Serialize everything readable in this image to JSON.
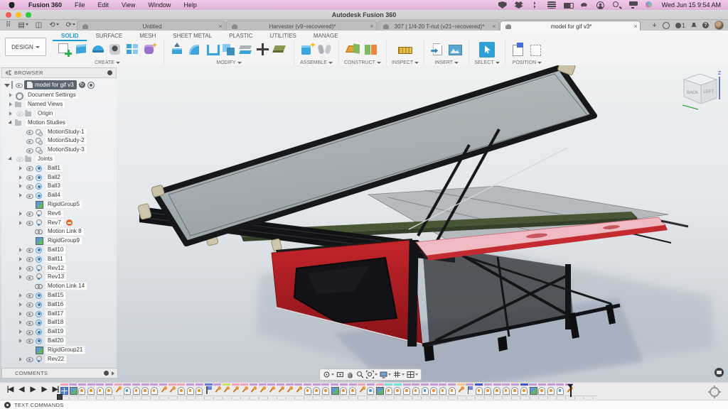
{
  "menubar": {
    "app_name": "Fusion 360",
    "items": [
      "File",
      "Edit",
      "View",
      "Window",
      "Help"
    ],
    "status_icons": [
      "shield",
      "dropbox",
      "bluetooth",
      "keyboard",
      "battery",
      "wifi",
      "account",
      "search",
      "display",
      "siri"
    ],
    "clock": "Wed Jun 15 9:54 AM"
  },
  "titlebar": {
    "title": "Autodesk Fusion 360"
  },
  "tabbar": {
    "close_glyph": "×",
    "new_tab_glyph": "+",
    "job_count": "1",
    "help_glyph": "?",
    "tabs": [
      {
        "label": "Untitled",
        "active": false
      },
      {
        "label": "Harvester (v9~recovered)*",
        "active": false
      },
      {
        "label": "307 | 1/4-20 T-nut (v21~recovered)*",
        "active": false
      },
      {
        "label": "model for gif v3*",
        "active": true
      }
    ]
  },
  "ribbon": {
    "workspace": "DESIGN",
    "tabs": [
      "SOLID",
      "SURFACE",
      "MESH",
      "SHEET METAL",
      "PLASTIC",
      "UTILITIES",
      "MANAGE"
    ],
    "active_tab": "SOLID",
    "groups": [
      {
        "label": "CREATE",
        "icons": [
          "sketch",
          "extrude",
          "revolve",
          "hole",
          "pattern",
          "form"
        ]
      },
      {
        "label": "MODIFY",
        "icons": [
          "presspull",
          "fillet",
          "shell",
          "combine",
          "offset",
          "move",
          "paint"
        ]
      },
      {
        "label": "ASSEMBLE",
        "icons": [
          "newcomp",
          "joint"
        ]
      },
      {
        "label": "CONSTRUCT",
        "icons": [
          "plane",
          "plane2"
        ]
      },
      {
        "label": "INSPECT",
        "icons": [
          "measure"
        ]
      },
      {
        "label": "INSERT",
        "icons": [
          "insert",
          "image"
        ]
      },
      {
        "label": "SELECT",
        "icons": [
          "select"
        ]
      },
      {
        "label": "POSITION",
        "icons": [
          "capture",
          "revert"
        ]
      }
    ]
  },
  "browser": {
    "header": "BROWSER",
    "root_label": "model for gif v3",
    "items": [
      {
        "label": "Document Settings",
        "icon": "gear",
        "arrow": "closed",
        "eye": "none",
        "depth": 1
      },
      {
        "label": "Named Views",
        "icon": "folder",
        "arrow": "closed",
        "eye": "none",
        "depth": 1
      },
      {
        "label": "Origin",
        "icon": "folder",
        "arrow": "closed",
        "eye": "dim",
        "depth": 1
      },
      {
        "label": "Motion Studies",
        "icon": "folder",
        "arrow": "open",
        "eye": "none",
        "depth": 1
      },
      {
        "label": "MotionStudy-1",
        "icon": "motion",
        "arrow": "none",
        "eye": "on",
        "depth": 2
      },
      {
        "label": "MotionStudy-2",
        "icon": "motion",
        "arrow": "none",
        "eye": "on",
        "depth": 2
      },
      {
        "label": "MotionStudy-3",
        "icon": "motion",
        "arrow": "none",
        "eye": "on",
        "depth": 2
      },
      {
        "label": "Joints",
        "icon": "folder",
        "arrow": "open",
        "eye": "dim",
        "depth": 1
      },
      {
        "label": "Ball1",
        "icon": "ball",
        "arrow": "closed",
        "eye": "on",
        "depth": 2
      },
      {
        "label": "Ball2",
        "icon": "ball",
        "arrow": "closed",
        "eye": "on",
        "depth": 2
      },
      {
        "label": "Ball3",
        "icon": "ball",
        "arrow": "closed",
        "eye": "on",
        "depth": 2
      },
      {
        "label": "Ball4",
        "icon": "ball",
        "arrow": "closed",
        "eye": "on",
        "depth": 2
      },
      {
        "label": "RigidGroup5",
        "icon": "rigid",
        "arrow": "none",
        "eye": "none",
        "depth": 2
      },
      {
        "label": "Rev6",
        "icon": "rev",
        "arrow": "closed",
        "eye": "on",
        "depth": 2
      },
      {
        "label": "Rev7",
        "icon": "rev",
        "arrow": "closed",
        "eye": "on",
        "depth": 2,
        "warn": true
      },
      {
        "label": "Motion Link 8",
        "icon": "link",
        "arrow": "none",
        "eye": "none",
        "depth": 2
      },
      {
        "label": "RigidGroup9",
        "icon": "rigid",
        "arrow": "none",
        "eye": "none",
        "depth": 2
      },
      {
        "label": "Ball10",
        "icon": "ball",
        "arrow": "closed",
        "eye": "on",
        "depth": 2
      },
      {
        "label": "Ball11",
        "icon": "ball",
        "arrow": "closed",
        "eye": "on",
        "depth": 2
      },
      {
        "label": "Rev12",
        "icon": "rev",
        "arrow": "closed",
        "eye": "on",
        "depth": 2
      },
      {
        "label": "Rev13",
        "icon": "rev",
        "arrow": "closed",
        "eye": "on",
        "depth": 2
      },
      {
        "label": "Motion Link 14",
        "icon": "link",
        "arrow": "none",
        "eye": "none",
        "depth": 2
      },
      {
        "label": "Ball15",
        "icon": "ball",
        "arrow": "closed",
        "eye": "on",
        "depth": 2
      },
      {
        "label": "Ball16",
        "icon": "ball",
        "arrow": "closed",
        "eye": "on",
        "depth": 2
      },
      {
        "label": "Ball17",
        "icon": "ball",
        "arrow": "closed",
        "eye": "on",
        "depth": 2
      },
      {
        "label": "Ball18",
        "icon": "ball",
        "arrow": "closed",
        "eye": "on",
        "depth": 2
      },
      {
        "label": "Ball19",
        "icon": "ball",
        "arrow": "closed",
        "eye": "on",
        "depth": 2
      },
      {
        "label": "Ball20",
        "icon": "ball",
        "arrow": "closed",
        "eye": "on",
        "depth": 2
      },
      {
        "label": "RigidGroup21",
        "icon": "rigid",
        "arrow": "none",
        "eye": "none",
        "depth": 2
      },
      {
        "label": "Rev22",
        "icon": "rev",
        "arrow": "closed",
        "eye": "on",
        "depth": 2
      }
    ]
  },
  "comments": {
    "label": "COMMENTS"
  },
  "viewcube": {
    "face_left": "BACK",
    "face_right": "LEFT",
    "axis_z": "Z"
  },
  "timeline": {
    "controls": [
      "|◀",
      "◀",
      "▶",
      "▶",
      "▶|"
    ],
    "bar_colors": {
      "purple": "#c49bd9",
      "pink": "#f2a3bc",
      "blue": "#6a79d9",
      "lime": "#cfe06a",
      "teal": "#6fe0d5",
      "orange": "#f5c98a",
      "indigo": "#4553c9"
    },
    "items": [
      {
        "icon": "ms",
        "bar": "pink"
      },
      {
        "icon": "rigid",
        "bar": "purple"
      },
      {
        "icon": "ball",
        "bar": "purple"
      },
      {
        "icon": "ball",
        "bar": "purple"
      },
      {
        "icon": "ball",
        "bar": "purple"
      },
      {
        "icon": "ball",
        "bar": "purple"
      },
      {
        "icon": "pin",
        "bar": "pink"
      },
      {
        "icon": "rev",
        "bar": "purple"
      },
      {
        "icon": "ball",
        "bar": "purple"
      },
      {
        "icon": "ball",
        "bar": "purple"
      },
      {
        "icon": "ball",
        "bar": "purple"
      },
      {
        "icon": "pin",
        "bar": "purple"
      },
      {
        "icon": "pin",
        "bar": "pink"
      },
      {
        "icon": "ball",
        "bar": "pink"
      },
      {
        "icon": "ball",
        "bar": "purple"
      },
      {
        "icon": "ball",
        "bar": "purple"
      },
      {
        "icon": "flag",
        "bar": "blue"
      },
      {
        "icon": "pin",
        "bar": "purple"
      },
      {
        "icon": "pin",
        "bar": "lime"
      },
      {
        "icon": "pin",
        "bar": "pink"
      },
      {
        "icon": "pin",
        "bar": "pink"
      },
      {
        "icon": "pin",
        "bar": "purple"
      },
      {
        "icon": "pin",
        "bar": "purple"
      },
      {
        "icon": "pin",
        "bar": "purple"
      },
      {
        "icon": "pin",
        "bar": "purple"
      },
      {
        "icon": "pin",
        "bar": "purple"
      },
      {
        "icon": "pin",
        "bar": "purple"
      },
      {
        "icon": "ball",
        "bar": "purple"
      },
      {
        "icon": "ball",
        "bar": "purple"
      },
      {
        "icon": "ball",
        "bar": "purple"
      },
      {
        "icon": "rigid",
        "bar": "purple"
      },
      {
        "icon": "ball",
        "bar": "purple"
      },
      {
        "icon": "ball",
        "bar": "purple"
      },
      {
        "icon": "pin",
        "bar": "pink"
      },
      {
        "icon": "rev",
        "bar": "purple"
      },
      {
        "icon": "rigid",
        "bar": "pink"
      },
      {
        "icon": "ball",
        "bar": "teal"
      },
      {
        "icon": "ball",
        "bar": "teal"
      },
      {
        "icon": "ball",
        "bar": "purple"
      },
      {
        "icon": "ball",
        "bar": "purple"
      },
      {
        "icon": "rev",
        "bar": "purple"
      },
      {
        "icon": "ball",
        "bar": "purple"
      },
      {
        "icon": "ball",
        "bar": "purple"
      },
      {
        "icon": "ball",
        "bar": "purple"
      },
      {
        "icon": "pin",
        "bar": "orange"
      },
      {
        "icon": "flag",
        "bar": "purple"
      },
      {
        "icon": "ball",
        "bar": "indigo"
      },
      {
        "icon": "ball",
        "bar": "purple"
      },
      {
        "icon": "ball",
        "bar": "purple"
      },
      {
        "icon": "ball",
        "bar": "purple"
      },
      {
        "icon": "ball",
        "bar": "purple"
      },
      {
        "icon": "ball",
        "bar": "indigo"
      },
      {
        "icon": "rigid",
        "bar": "purple"
      },
      {
        "icon": "ball",
        "bar": "purple"
      },
      {
        "icon": "ball",
        "bar": "purple"
      },
      {
        "icon": "rev",
        "bar": "purple"
      },
      {
        "icon": "pin",
        "bar": "purple"
      }
    ]
  },
  "statusbar": {
    "label": "TEXT COMMANDS"
  },
  "colors": {
    "accent_blue": "#1a9bd7",
    "body_red": "#bb1f24",
    "panel_pink": "#f0bac2",
    "deck_green": "#475734",
    "frame_black": "#17181a"
  }
}
